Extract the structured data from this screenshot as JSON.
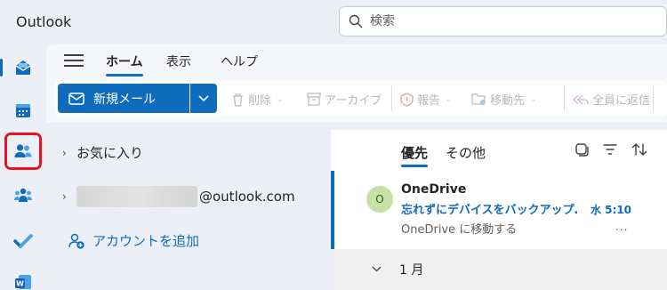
{
  "app": {
    "title": "Outlook"
  },
  "search": {
    "placeholder": "検索"
  },
  "rail": {
    "items": [
      {
        "name": "mail-icon"
      },
      {
        "name": "calendar-icon"
      },
      {
        "name": "people-icon"
      },
      {
        "name": "groups-icon"
      },
      {
        "name": "todo-icon"
      },
      {
        "name": "word-icon"
      }
    ]
  },
  "ribbon": {
    "tabs": [
      "ホーム",
      "表示",
      "ヘルプ"
    ],
    "new_mail": "新規メール",
    "tools": {
      "delete": "削除",
      "archive": "アーカイブ",
      "report": "報告",
      "move": "移動先",
      "reply_all": "全員に返信"
    }
  },
  "folders": {
    "favorites": "お気に入り",
    "account_suffix": "@outlook.com",
    "add_account": "アカウントを追加"
  },
  "message_list": {
    "tabs": [
      "優先",
      "その他"
    ],
    "messages": [
      {
        "avatar": "O",
        "sender": "OneDrive",
        "subject": "忘れずにデバイスをバックアップ…",
        "time": "水 5:10",
        "preview": "OneDrive に移動する",
        "more": "..."
      }
    ],
    "group": "1 月"
  },
  "colors": {
    "accent": "#0f6cbd",
    "highlight": "#e8141b",
    "avatar_bg": "#c5e1a5"
  }
}
